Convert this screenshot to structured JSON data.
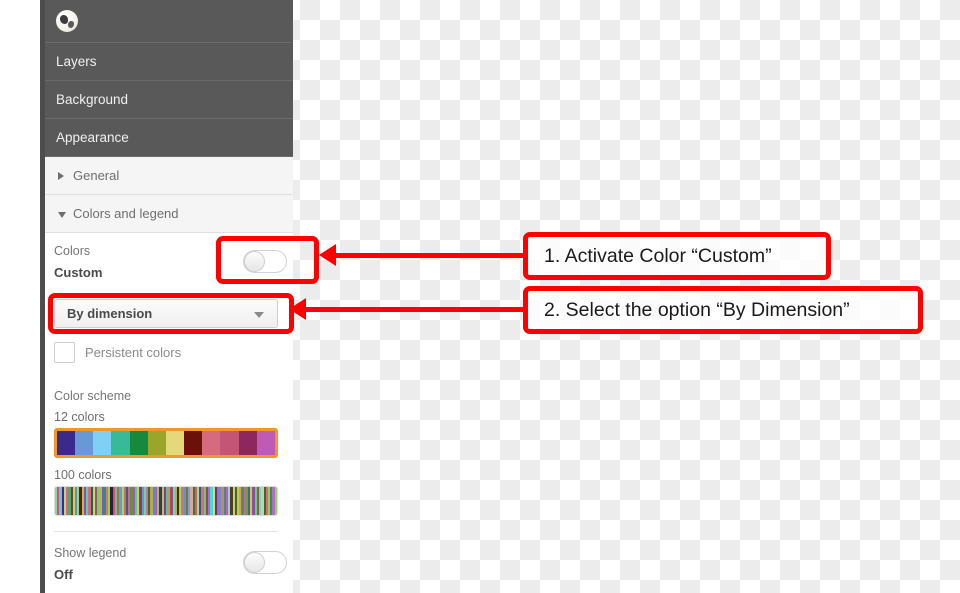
{
  "panel": {
    "icon": "globe-map-icon",
    "tabs": [
      {
        "label": "Layers"
      },
      {
        "label": "Background"
      },
      {
        "label": "Appearance"
      }
    ],
    "sections": [
      {
        "label": "General",
        "expanded": false,
        "caret": "caret-right-icon"
      },
      {
        "label": "Colors and legend",
        "expanded": true,
        "caret": "caret-down-icon"
      }
    ],
    "colors": {
      "label": "Colors",
      "value": "Custom",
      "toggle_state": "off"
    },
    "dimension_select": {
      "selected": "By dimension",
      "caret": "chevron-down-icon"
    },
    "persistent_colors": {
      "label": "Persistent colors",
      "checked": false
    },
    "color_scheme": {
      "label": "Color scheme",
      "schemes": [
        {
          "label": "12 colors",
          "selected": true,
          "colors": [
            "#3b2a8c",
            "#6699d6",
            "#7fd0f2",
            "#38b99a",
            "#17893e",
            "#9aa62b",
            "#e3d87a",
            "#6b1109",
            "#d66a80",
            "#c45576",
            "#8e2760",
            "#bf5bb5"
          ]
        },
        {
          "label": "100 colors",
          "selected": false,
          "colors": [
            "#8ad6a0",
            "#d94f7a",
            "#6cc3d8",
            "#3b2a8c",
            "#b8e060",
            "#e85a9c",
            "#4fa86b",
            "#7a3d2e",
            "#c9d84f",
            "#5b8fd6",
            "#a0d86c",
            "#3d2a1f",
            "#e0a84f",
            "#8c4fb8",
            "#4fd8a0",
            "#d66a80",
            "#2e5b3d",
            "#c4d86c",
            "#9b4f8c",
            "#6bd84f",
            "#d8a84f",
            "#4f6bd8",
            "#3d8c5b",
            "#e06c9b",
            "#8cd84f",
            "#2a1f3d",
            "#d84f6b",
            "#5bc4a0",
            "#b86c3d",
            "#4fa8d8",
            "#9cd86c",
            "#d86c4f",
            "#3d5b8c",
            "#c46ca0",
            "#6b8c3d",
            "#a84fd8",
            "#4fd86c",
            "#d8c46c",
            "#8c3d5b",
            "#5b9cd8",
            "#6cd8a8",
            "#d86ca0",
            "#3d6b2a",
            "#b8a84f",
            "#4f8cd8",
            "#d84f9c",
            "#8cc46b",
            "#2e3d5b",
            "#e0a86c",
            "#6b4f8c",
            "#4fc4a8",
            "#d88c4f",
            "#9c4f6b",
            "#6cd8c4",
            "#c4a84f",
            "#3d2e1f",
            "#a0d84f",
            "#d86c8c",
            "#4f9cc4",
            "#8c6b3d",
            "#6ba8d8",
            "#d8a89c",
            "#4f6b3d",
            "#c46b4f",
            "#9cd8a0",
            "#3d4f8c",
            "#e06c6b",
            "#6bc48c",
            "#8c4f3d",
            "#a86cd8",
            "#4fd8d8",
            "#d8d86c",
            "#5b3d6b",
            "#9c6bd8",
            "#6b8cd8",
            "#c48c4f",
            "#3d8c8c",
            "#d84fc4",
            "#8cd8c4",
            "#4f3d2e",
            "#b8d86c",
            "#6b4f2e",
            "#a8d84f",
            "#d89c6b",
            "#4f8c6b",
            "#c46b8c",
            "#6c9c4f",
            "#3d6b8c",
            "#d8c44f",
            "#8c4fa8",
            "#5bd86c",
            "#a84f4f",
            "#6bd8d8",
            "#c4d89c",
            "#4f5b3d",
            "#d86c6c",
            "#9cc46b",
            "#3d8c4f",
            "#b86cc4",
            "#8cd86b"
          ]
        }
      ]
    },
    "show_legend": {
      "label": "Show legend",
      "value": "Off",
      "toggle_state": "off"
    }
  },
  "annotations": [
    {
      "text": "1. Activate Color “Custom”"
    },
    {
      "text": "2. Select the option “By Dimension”"
    }
  ],
  "colors": {
    "annotation": "#ff0000",
    "panel_header": "#595959",
    "swatch_selected_border": "#f0962d"
  }
}
